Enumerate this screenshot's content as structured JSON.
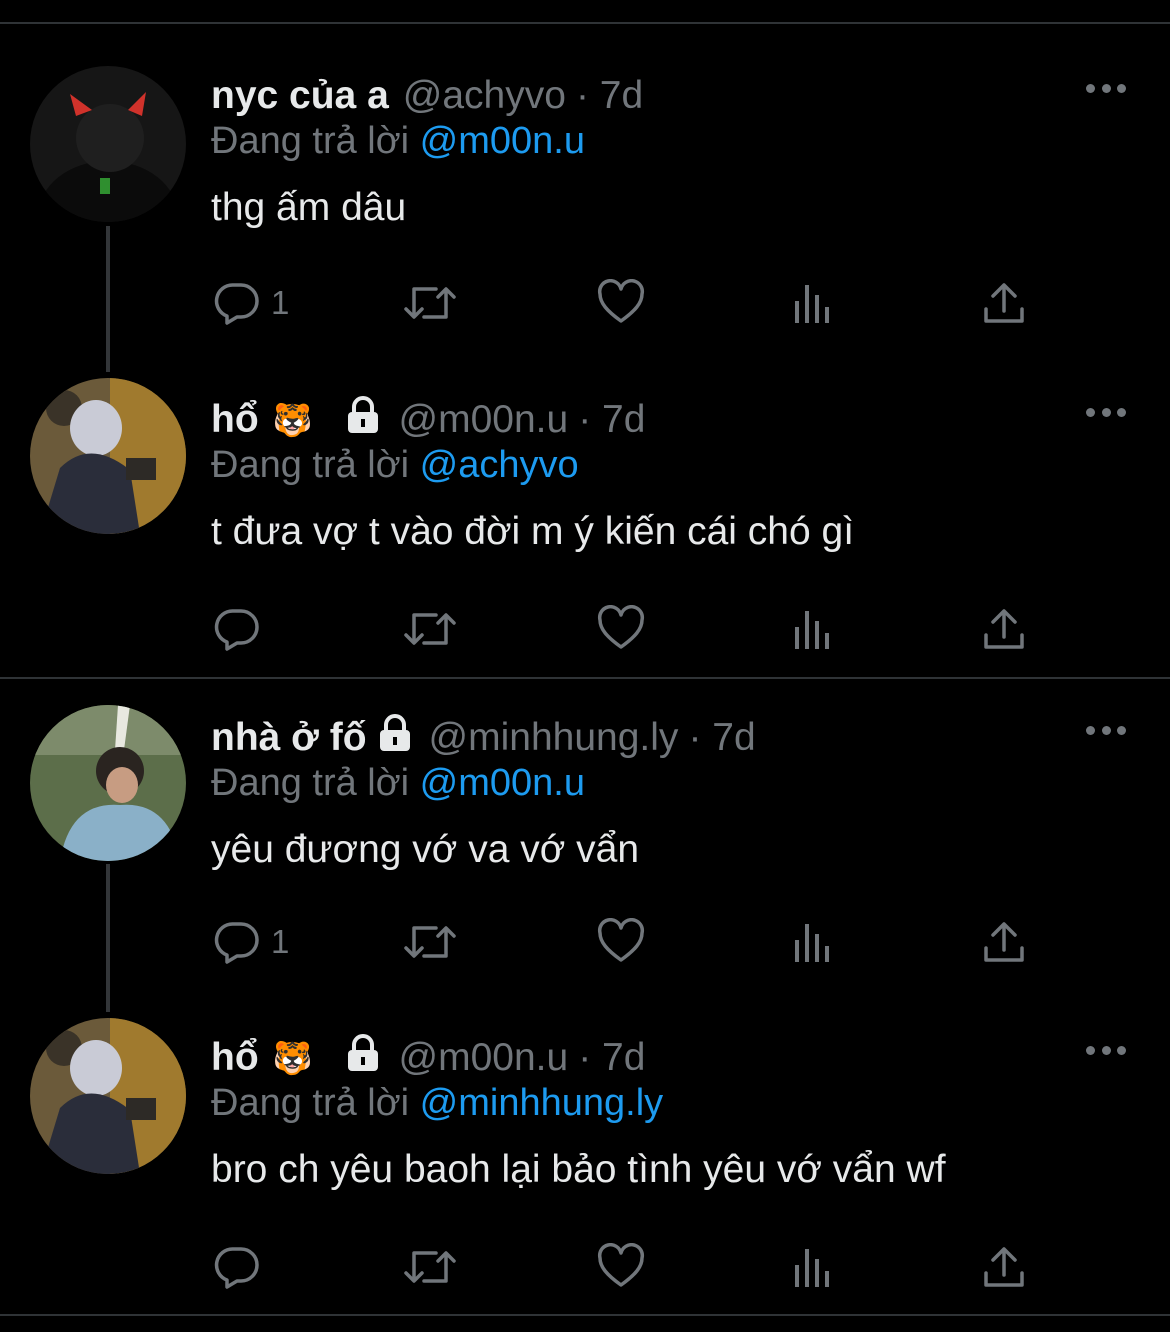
{
  "tweets": [
    {
      "name": "nyc của a",
      "emoji": "",
      "locked": false,
      "handle": "@achyvo",
      "time": "· 7d",
      "replying_prefix": "Đang trả lời",
      "replying_to": "@m00n.u",
      "text": "thg ấm dâu",
      "reply_count": "1"
    },
    {
      "name": "hổ",
      "emoji": "🐯",
      "locked": true,
      "handle": "@m00n.u",
      "time": "· 7d",
      "replying_prefix": "Đang trả lời",
      "replying_to": "@achyvo",
      "text": "t đưa vợ t vào đời m ý kiến cái chó gì",
      "reply_count": ""
    },
    {
      "name": "nhà ở fố",
      "emoji": "",
      "locked": true,
      "handle": "@minhhung.ly",
      "time": "· 7d",
      "replying_prefix": "Đang trả lời",
      "replying_to": "@m00n.u",
      "text": "yêu đương vớ va vớ vẩn",
      "reply_count": "1"
    },
    {
      "name": "hổ",
      "emoji": "🐯",
      "locked": true,
      "handle": "@m00n.u",
      "time": "· 7d",
      "replying_prefix": "Đang trả lời",
      "replying_to": "@minhhung.ly",
      "text": "bro ch yêu baoh lại bảo tình yêu vớ vẩn wf",
      "reply_count": ""
    }
  ],
  "icons": {
    "reply": "reply-icon",
    "retweet": "retweet-icon",
    "like": "heart-icon",
    "views": "views-icon",
    "share": "share-icon",
    "more": "more-icon",
    "lock": "lock-icon"
  },
  "colors": {
    "background": "#000000",
    "text": "#e7e9ea",
    "secondary": "#71767b",
    "link": "#1d9bf0",
    "divider": "#2f3336"
  }
}
